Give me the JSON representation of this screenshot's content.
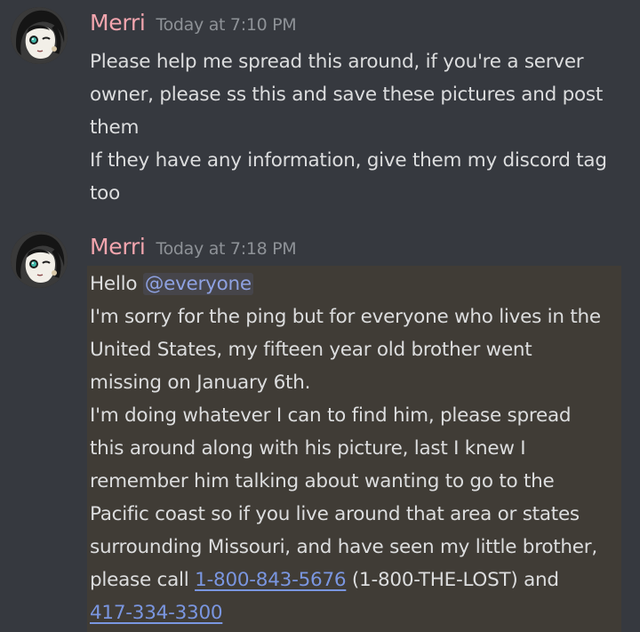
{
  "messages": [
    {
      "username": "Merri",
      "timestamp": "Today at 7:10 PM",
      "username_color": "#f3a5ae",
      "avatar_icon": "anime-character-avatar",
      "lines": [
        "Please help me spread this around, if you're a server",
        "owner, please ss this and save these pictures and post",
        "them",
        "If they have any information, give them my discord tag",
        "too"
      ]
    },
    {
      "username": "Merri",
      "timestamp": "Today at 7:18 PM",
      "username_color": "#f3a5ae",
      "avatar_icon": "anime-character-avatar",
      "highlight_color": "#403c36",
      "greeting": "Hello ",
      "mention": "@everyone",
      "lines": [
        "I'm sorry for the ping but for everyone who lives in the",
        "United States, my fifteen year old brother went",
        "missing on January 6th.",
        "I'm doing whatever I can to find him, please spread",
        "this around along with his picture, last I knew I",
        "remember him talking about wanting to go to the",
        "Pacific coast so if you live around that area or states",
        "surrounding Missouri, and have seen my little brother,"
      ],
      "call_prefix": "please call ",
      "phone_1": "1-800-843-5676",
      "phone_1_suffix": " (1-800-THE-LOST) and",
      "phone_2": "417-334-3300"
    }
  ],
  "colors": {
    "background": "#36393f",
    "text": "#dcddde",
    "timestamp": "#8e9297",
    "link": "#7a96e0",
    "mention": "#8ea1e1"
  }
}
